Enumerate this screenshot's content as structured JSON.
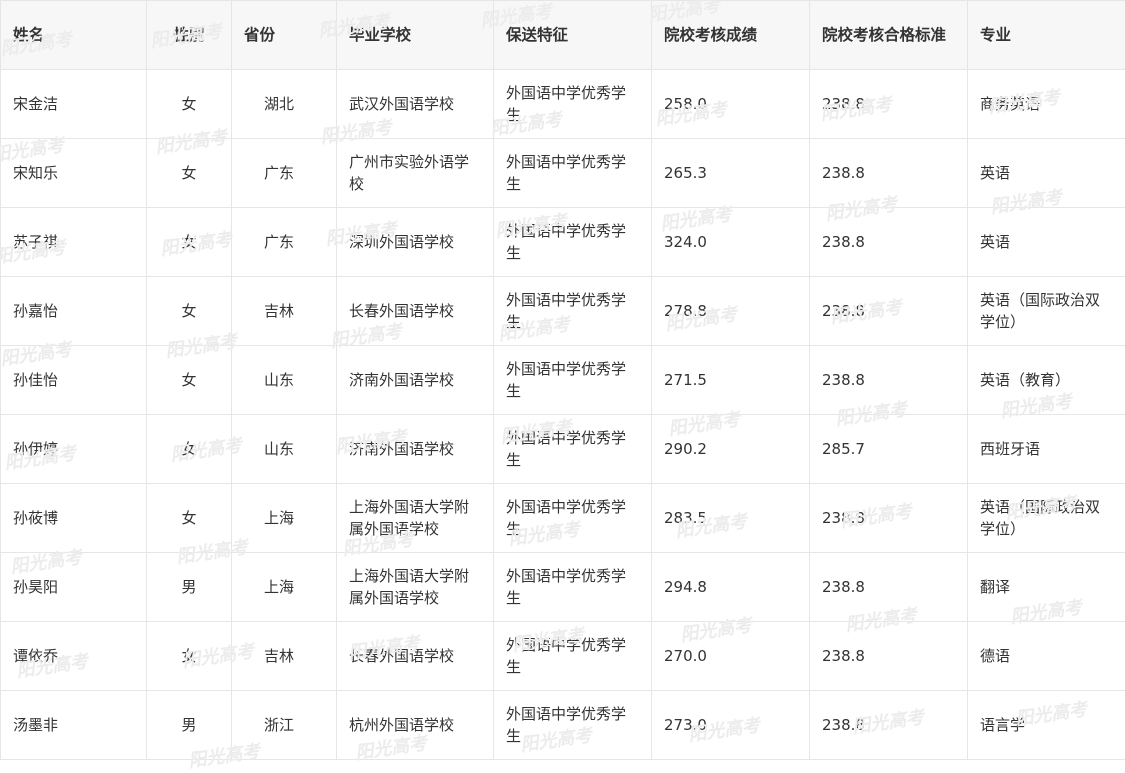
{
  "table": {
    "headers": [
      "姓名",
      "性别",
      "省份",
      "毕业学校",
      "保送特征",
      "院校考核成绩",
      "院校考核合格标准",
      "专业"
    ],
    "rows": [
      [
        "宋金洁",
        "女",
        "湖北",
        "武汉外国语学校",
        "外国语中学优秀学生",
        "258.0",
        "238.8",
        "商务英语"
      ],
      [
        "宋知乐",
        "女",
        "广东",
        "广州市实验外语学校",
        "外国语中学优秀学生",
        "265.3",
        "238.8",
        "英语"
      ],
      [
        "苏子祺",
        "女",
        "广东",
        "深圳外国语学校",
        "外国语中学优秀学生",
        "324.0",
        "238.8",
        "英语"
      ],
      [
        "孙嘉怡",
        "女",
        "吉林",
        "长春外国语学校",
        "外国语中学优秀学生",
        "278.8",
        "238.8",
        "英语（国际政治双学位）"
      ],
      [
        "孙佳怡",
        "女",
        "山东",
        "济南外国语学校",
        "外国语中学优秀学生",
        "271.5",
        "238.8",
        "英语（教育）"
      ],
      [
        "孙伊婷",
        "女",
        "山东",
        "济南外国语学校",
        "外国语中学优秀学生",
        "290.2",
        "285.7",
        "西班牙语"
      ],
      [
        "孙莜博",
        "女",
        "上海",
        "上海外国语大学附属外国语学校",
        "外国语中学优秀学生",
        "283.5",
        "238.8",
        "英语（国际政治双学位）"
      ],
      [
        "孙昊阳",
        "男",
        "上海",
        "上海外国语大学附属外国语学校",
        "外国语中学优秀学生",
        "294.8",
        "238.8",
        "翻译"
      ],
      [
        "谭依乔",
        "女",
        "吉林",
        "长春外国语学校",
        "外国语中学优秀学生",
        "270.0",
        "238.8",
        "德语"
      ],
      [
        "汤墨非",
        "男",
        "浙江",
        "杭州外国语学校",
        "外国语中学优秀学生",
        "273.0",
        "238.8",
        "语言学"
      ]
    ]
  },
  "watermark": {
    "text": "阳光高考"
  }
}
